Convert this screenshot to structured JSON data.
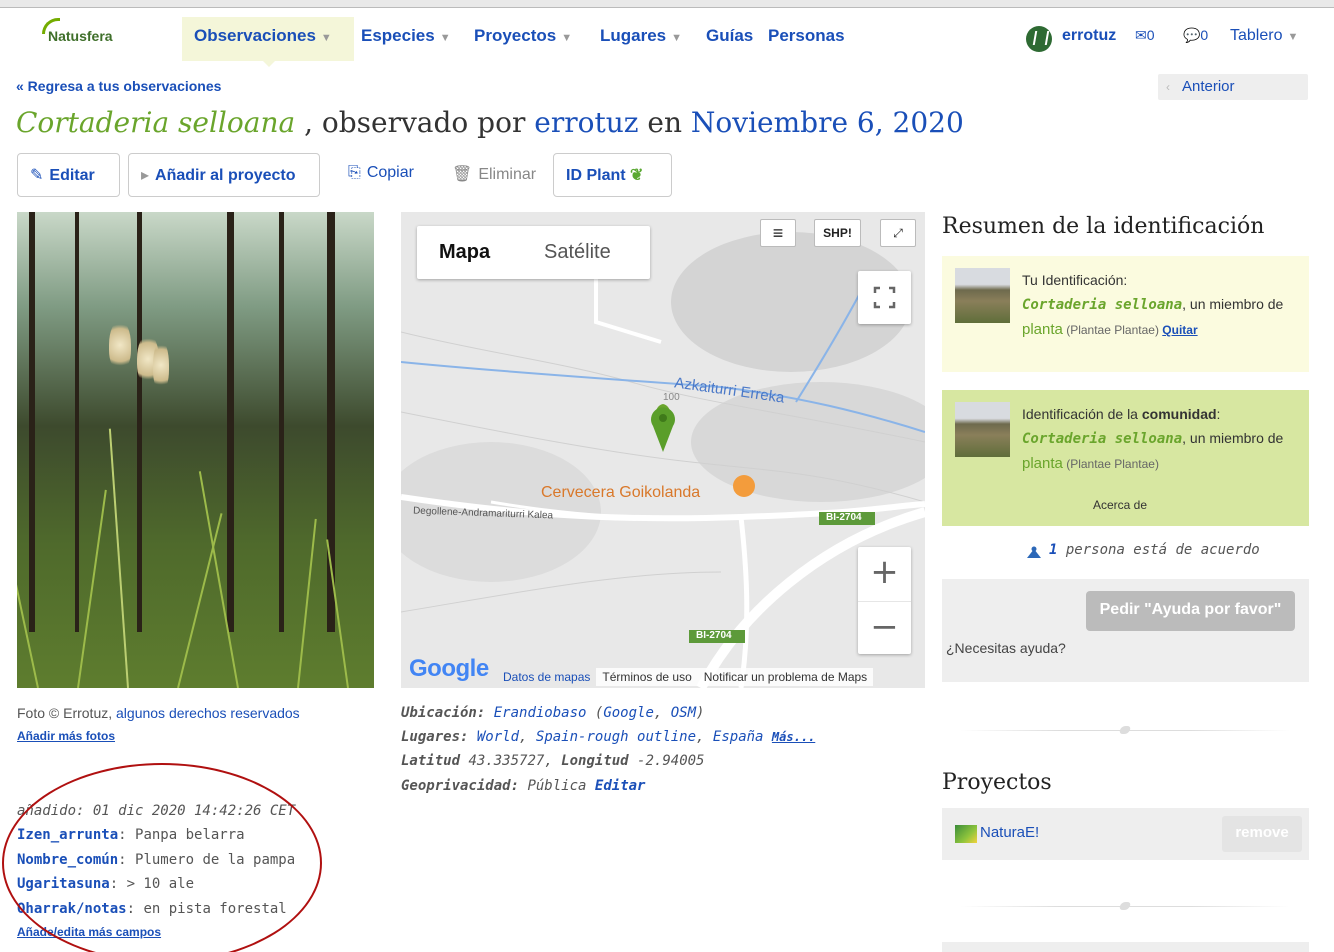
{
  "nav": {
    "logo": "Natusfera",
    "items": [
      {
        "label": "Observaciones",
        "dropdown": true
      },
      {
        "label": "Especies",
        "dropdown": true
      },
      {
        "label": "Proyectos",
        "dropdown": true
      },
      {
        "label": "Lugares",
        "dropdown": true
      },
      {
        "label": "Guías",
        "dropdown": false
      },
      {
        "label": "Personas",
        "dropdown": false
      }
    ],
    "user": "errotuz",
    "messages": "✉0",
    "comments": "💬0",
    "dashboard": "Tablero"
  },
  "breadcrumb": {
    "back": "« Regresa a tus observaciones",
    "prev": "Anterior"
  },
  "title": {
    "species": "Cortaderia selloana",
    "observed_by": " , observado por ",
    "user": "errotuz",
    "on": " en ",
    "date": "Noviembre 6, 2020"
  },
  "toolbar": {
    "edit": "Editar",
    "add_project": "Añadir al proyecto",
    "copy": "Copiar",
    "delete": "Eliminar",
    "idplant": "ID Plant"
  },
  "photo": {
    "credit_prefix": "Foto © Errotuz, ",
    "credit_link": "algunos derechos reservados",
    "add_more": "Añadir más fotos"
  },
  "fields": {
    "added": "añadido: 01 dic 2020 14:42:26 CET",
    "items": [
      {
        "key": "Izen_arrunta",
        "value": "Panpa belarra"
      },
      {
        "key": "Nombre_común",
        "value": "Plumero de la pampa"
      },
      {
        "key": "Ugaritasuna",
        "value": "> 10 ale"
      },
      {
        "key": "Oharrak/notas",
        "value": "en pista forestal"
      }
    ],
    "edit_more": "Añade/edita más campos"
  },
  "map": {
    "type_map": "Mapa",
    "type_satellite": "Satélite",
    "layers_btn": "≡",
    "shp_btn": "SHP!",
    "external_btn": "⤢",
    "labels": {
      "stream": "Azkaiturri Erreka",
      "elevation": "100",
      "brewery": "Cervecera Goikolanda",
      "street": "Degollene-Andramariturri Kalea",
      "road1": "BI-2704",
      "road2": "BI-2704"
    },
    "zoom_in": "+",
    "zoom_out": "−",
    "google": "Google",
    "footer": [
      "Datos de mapas",
      "Términos de uso",
      "Notificar un problema de Maps"
    ]
  },
  "location": {
    "place_label": "Ubicación:",
    "place": "Erandiobaso",
    "google": "Google",
    "osm": "OSM",
    "places_label": "Lugares:",
    "places": [
      "World",
      "Spain-rough outline",
      "España"
    ],
    "more": "Más...",
    "lat_label": "Latitud",
    "lat": "43.335727",
    "lon_label": "Longitud",
    "lon": "-2.94005",
    "geoprivacy_label": "Geoprivacidad:",
    "geoprivacy": "Pública",
    "geoprivacy_edit": "Editar"
  },
  "id_summary": {
    "title": "Resumen de la identificación",
    "yours": {
      "label": "Tu Identificación:",
      "taxon": "Cortaderia selloana",
      "member": ", un miembro de ",
      "group": "planta",
      "sci": " (Plantae Plantae) ",
      "remove": "Quitar"
    },
    "community": {
      "label_a": "Identificación de la ",
      "label_b": "comunidad",
      "label_c": ":",
      "taxon": "Cortaderia selloana",
      "member": ", un miembro de ",
      "group": "planta",
      "sci": " (Plantae Plantae)",
      "about": "Acerca de"
    },
    "agree_count": "1",
    "agree_text": " persona está de acuerdo",
    "help_button": "Pedir \"Ayuda por favor\"",
    "help_text": "¿Necesitas ayuda?"
  },
  "projects": {
    "title": "Proyectos",
    "items": [
      {
        "name": "NaturaE!",
        "remove": "remove"
      }
    ]
  }
}
